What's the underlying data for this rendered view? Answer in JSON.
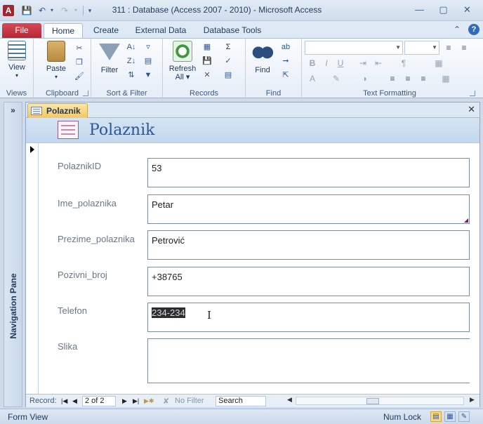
{
  "window": {
    "title": "311 : Database (Access 2007 - 2010)  -  Microsoft Access",
    "app_icon_letter": "A",
    "qat_icons": [
      "save-icon",
      "undo-icon",
      "redo-icon",
      "customize-qat-icon"
    ],
    "controls": {
      "minimize": "—",
      "maximize": "▢",
      "close": "✕"
    }
  },
  "ribbon": {
    "tabs": [
      {
        "label": "File"
      },
      {
        "label": "Home"
      },
      {
        "label": "Create"
      },
      {
        "label": "External Data"
      },
      {
        "label": "Database Tools"
      }
    ],
    "active_tab": "Home",
    "groups": {
      "views": {
        "label": "Views",
        "view_label": "View"
      },
      "clipboard": {
        "label": "Clipboard",
        "paste_label": "Paste"
      },
      "sort_filter": {
        "label": "Sort & Filter",
        "filter_label": "Filter"
      },
      "records": {
        "label": "Records",
        "refresh_label": "Refresh",
        "refresh_sub": "All ▾"
      },
      "find": {
        "label": "Find",
        "find_label": "Find"
      },
      "text_formatting": {
        "label": "Text Formatting"
      }
    }
  },
  "navigation_pane": {
    "label": "Navigation Pane",
    "toggle": "»"
  },
  "document": {
    "tab_label": "Polaznik",
    "close": "✕",
    "form_title": "Polaznik",
    "fields": [
      {
        "label": "PolaznikID",
        "value": "53"
      },
      {
        "label": "Ime_polaznika",
        "value": "Petar"
      },
      {
        "label": "Prezime_polaznika",
        "value": "Petrović"
      },
      {
        "label": "Pozivni_broj",
        "value": "+38765"
      },
      {
        "label": "Telefon",
        "value": "234-234"
      },
      {
        "label": "Slika",
        "value": ""
      }
    ],
    "record_nav": {
      "label": "Record:",
      "position": "2 of 2",
      "filter": "No Filter",
      "search": "Search"
    }
  },
  "status_bar": {
    "left": "Form View",
    "num_lock": "Num Lock"
  }
}
